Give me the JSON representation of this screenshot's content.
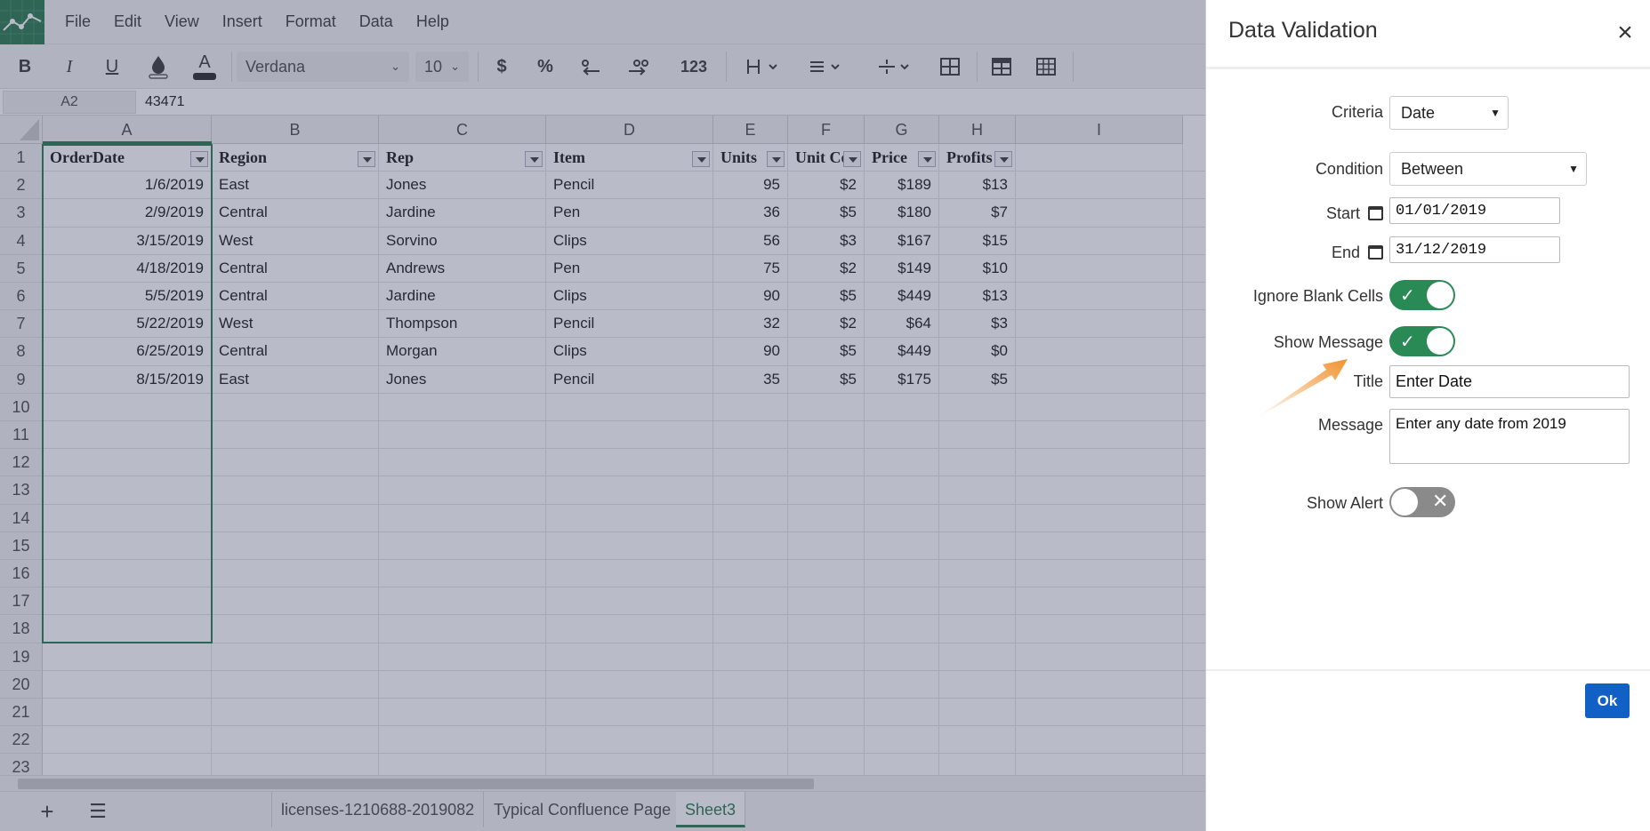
{
  "menubar": {
    "items": [
      "File",
      "Edit",
      "View",
      "Insert",
      "Format",
      "Data",
      "Help"
    ]
  },
  "toolbar": {
    "bold": "B",
    "italic": "I",
    "underline": "U",
    "font_color": "A",
    "font_name": "Verdana",
    "font_size": "10",
    "currency": "$",
    "percent": "%",
    "number_format": "123"
  },
  "formula_bar": {
    "name_box": "A2",
    "value": "43471"
  },
  "columns": [
    "A",
    "B",
    "C",
    "D",
    "E",
    "F",
    "G",
    "H",
    "I"
  ],
  "rows": [
    "1",
    "2",
    "3",
    "4",
    "5",
    "6",
    "7",
    "8",
    "9",
    "10",
    "11",
    "12",
    "13",
    "14",
    "15",
    "16",
    "17",
    "18",
    "19",
    "20",
    "21",
    "22",
    "23"
  ],
  "headers": [
    "OrderDate",
    "Region",
    "Rep",
    "Item",
    "Units",
    "Unit Cost",
    "Price",
    "Profits"
  ],
  "table": [
    [
      "1/6/2019",
      "East",
      "Jones",
      "Pencil",
      "95",
      "$2",
      "$189",
      "$13"
    ],
    [
      "2/9/2019",
      "Central",
      "Jardine",
      "Pen",
      "36",
      "$5",
      "$180",
      "$7"
    ],
    [
      "3/15/2019",
      "West",
      "Sorvino",
      "Clips",
      "56",
      "$3",
      "$167",
      "$15"
    ],
    [
      "4/18/2019",
      "Central",
      "Andrews",
      "Pen",
      "75",
      "$2",
      "$149",
      "$10"
    ],
    [
      "5/5/2019",
      "Central",
      "Jardine",
      "Clips",
      "90",
      "$5",
      "$449",
      "$13"
    ],
    [
      "5/22/2019",
      "West",
      "Thompson",
      "Pencil",
      "32",
      "$2",
      "$64",
      "$3"
    ],
    [
      "6/25/2019",
      "Central",
      "Morgan",
      "Clips",
      "90",
      "$5",
      "$449",
      "$0"
    ],
    [
      "8/15/2019",
      "East",
      "Jones",
      "Pencil",
      "35",
      "$5",
      "$175",
      "$5"
    ]
  ],
  "sheets": {
    "tabs": [
      "licenses-1210688-2019082",
      "Typical Confluence Page",
      "Sheet3"
    ],
    "active": "Sheet3"
  },
  "dialog": {
    "title": "Data Validation",
    "close": "×",
    "criteria_label": "Criteria",
    "criteria_value": "Date",
    "condition_label": "Condition",
    "condition_value": "Between",
    "start_label": "Start",
    "start_value": "01/01/2019",
    "end_label": "End",
    "end_value": "31/12/2019",
    "ignore_blank_label": "Ignore Blank Cells",
    "ignore_blank_on": true,
    "show_message_label": "Show Message",
    "show_message_on": true,
    "title_label": "Title",
    "title_value": "Enter Date",
    "message_label": "Message",
    "message_value": "Enter any date from 2019",
    "show_alert_label": "Show Alert",
    "show_alert_on": false,
    "ok_label": "Ok"
  },
  "colors": {
    "accent_green": "#217346",
    "toggle_on": "#2a8a55",
    "ok_blue": "#1160c6",
    "annotation_arrow": "#f0922e"
  }
}
